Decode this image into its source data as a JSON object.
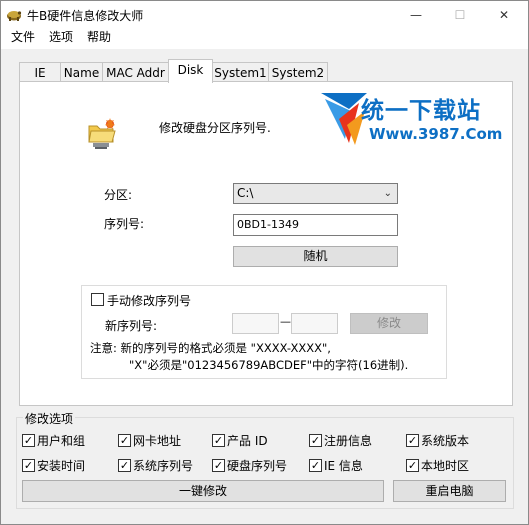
{
  "window": {
    "title": "牛B硬件信息修改大师",
    "controls": {
      "minimize": "—",
      "maximize": "☐",
      "close": "✕"
    }
  },
  "menu": [
    "文件",
    "选项",
    "帮助"
  ],
  "tabs": [
    {
      "label": "IE",
      "active": false
    },
    {
      "label": "Name",
      "active": false
    },
    {
      "label": "MAC Addr",
      "active": false
    },
    {
      "label": "Disk",
      "active": true
    },
    {
      "label": "System1",
      "active": false
    },
    {
      "label": "System2",
      "active": false
    }
  ],
  "disk_tab": {
    "heading": "修改硬盘分区序列号.",
    "partition_label": "分区:",
    "partition_value": "C:\\",
    "serial_label": "序列号:",
    "serial_value": "0BD1-1349",
    "random_button": "随机",
    "manual": {
      "checkbox_label": "手动修改序列号",
      "checked": false,
      "new_serial_label": "新序列号:",
      "separator": "—",
      "part1": "",
      "part2": "",
      "apply_button": "修改",
      "note_line1": "注意: 新的序列号的格式必须是 \"XXXX-XXXX\",",
      "note_line2": "\"X\"必须是\"0123456789ABCDEF\"中的字符(16进制)."
    }
  },
  "watermark": {
    "title": "统一下载站",
    "url": "Www.3987.Com",
    "colors": {
      "blue": "#0d6fc4",
      "red": "#e8331c",
      "orange": "#f39a1e"
    }
  },
  "options": {
    "title": "修改选项",
    "items": [
      {
        "label": "用户和组",
        "checked": true
      },
      {
        "label": "网卡地址",
        "checked": true
      },
      {
        "label": "产品 ID",
        "checked": true
      },
      {
        "label": "注册信息",
        "checked": true
      },
      {
        "label": "系统版本",
        "checked": true
      },
      {
        "label": "安装时间",
        "checked": true
      },
      {
        "label": "系统序列号",
        "checked": true
      },
      {
        "label": "硬盘序列号",
        "checked": true
      },
      {
        "label": "IE 信息",
        "checked": true
      },
      {
        "label": "本地时区",
        "checked": true
      }
    ],
    "one_click_button": "一键修改",
    "restart_button": "重启电脑"
  }
}
